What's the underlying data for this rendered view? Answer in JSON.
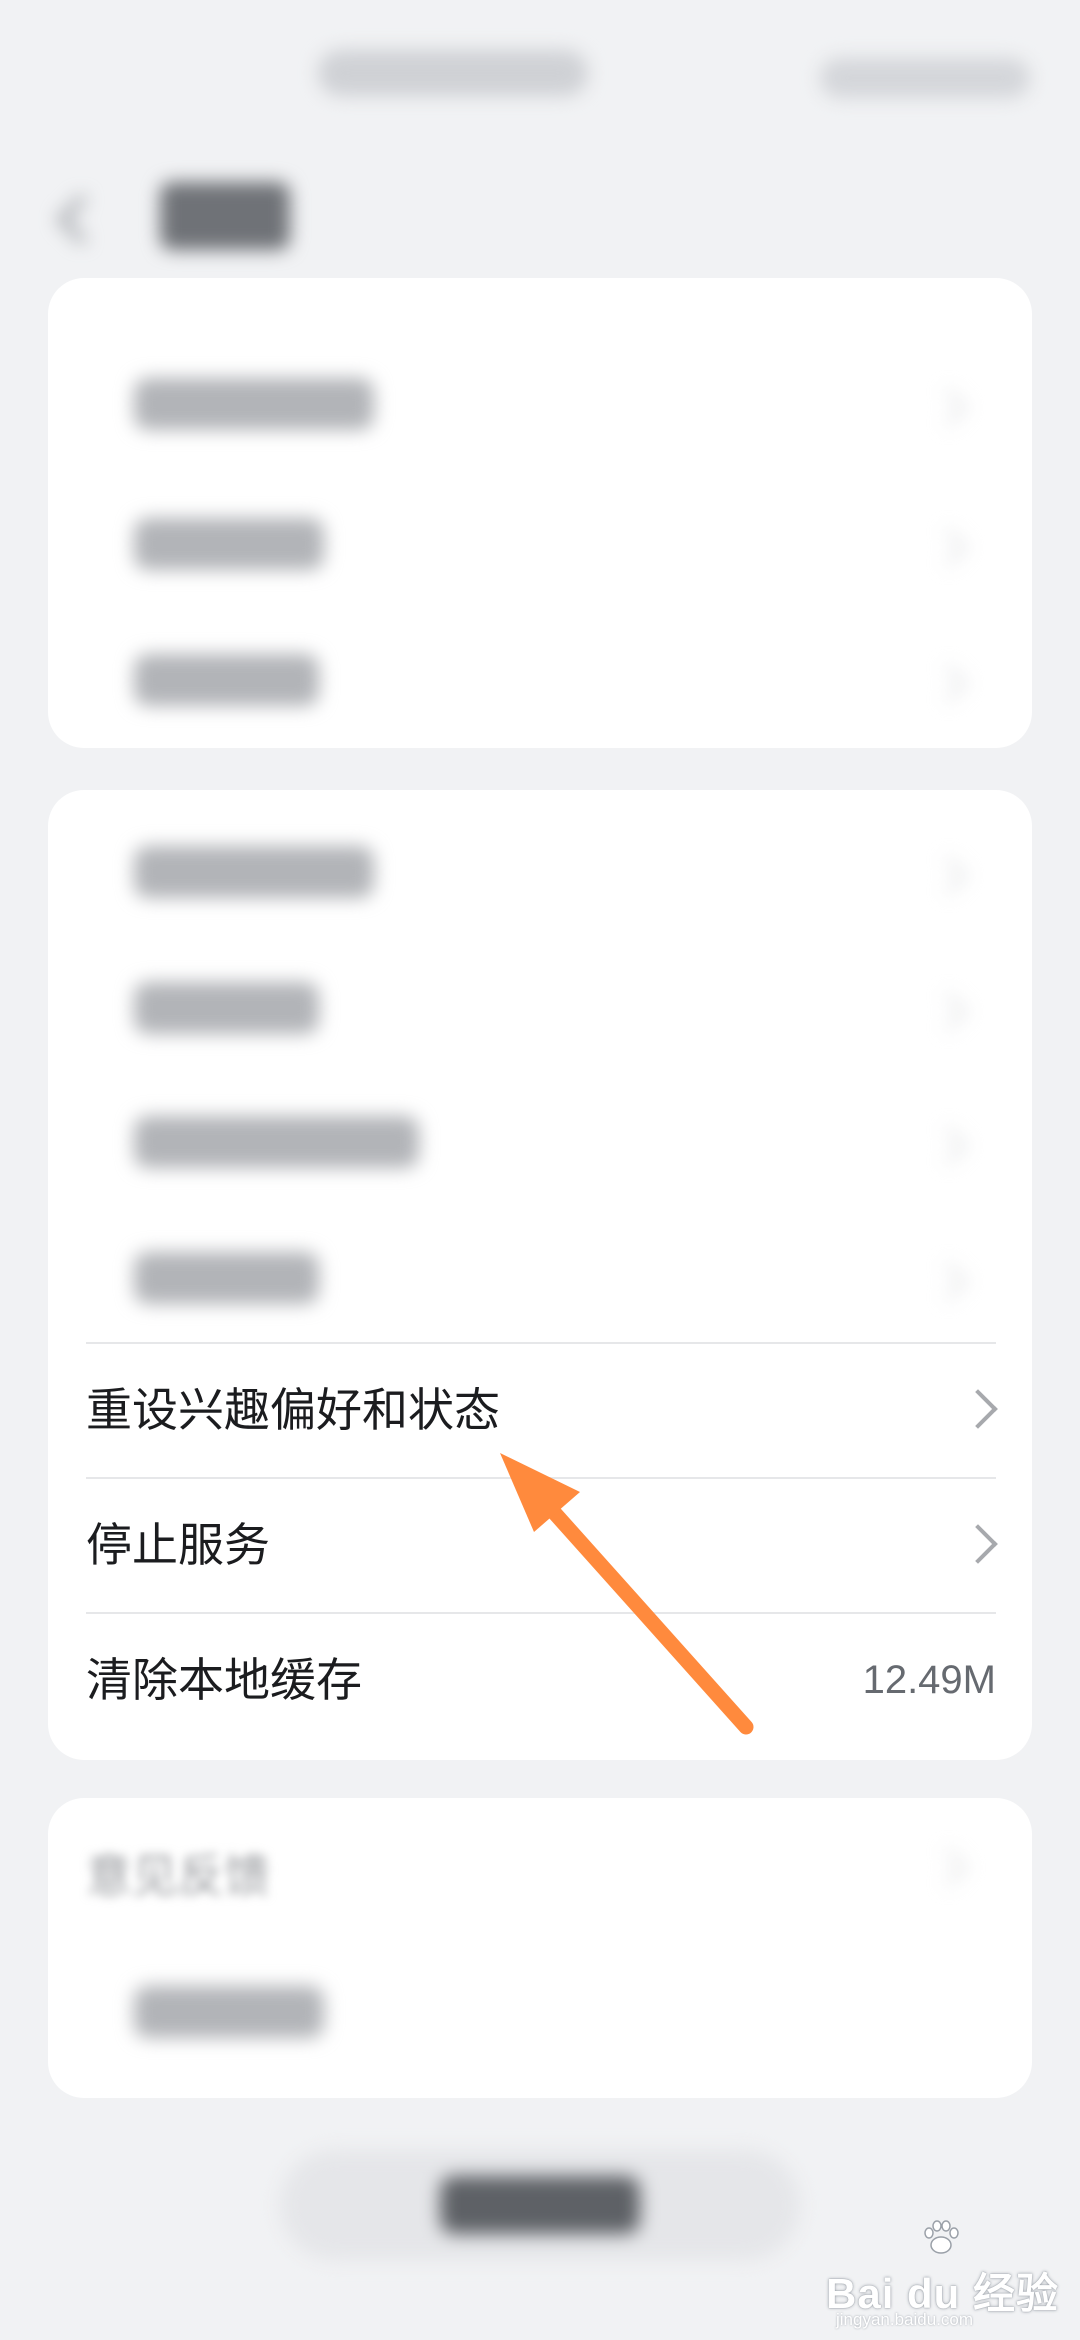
{
  "settings": {
    "reset_preferences": {
      "label": "重设兴趣偏好和状态"
    },
    "stop_service": {
      "label": "停止服务"
    },
    "clear_cache": {
      "label": "清除本地缓存",
      "value": "12.49M"
    },
    "feedback": {
      "label": "意见反馈"
    }
  },
  "watermark": {
    "brand": "Bai du 经验",
    "url": "jingyan.baidu.com"
  },
  "colors": {
    "accent_arrow": "#ff8a3d",
    "card": "#ffffff",
    "background": "#f1f2f4"
  }
}
